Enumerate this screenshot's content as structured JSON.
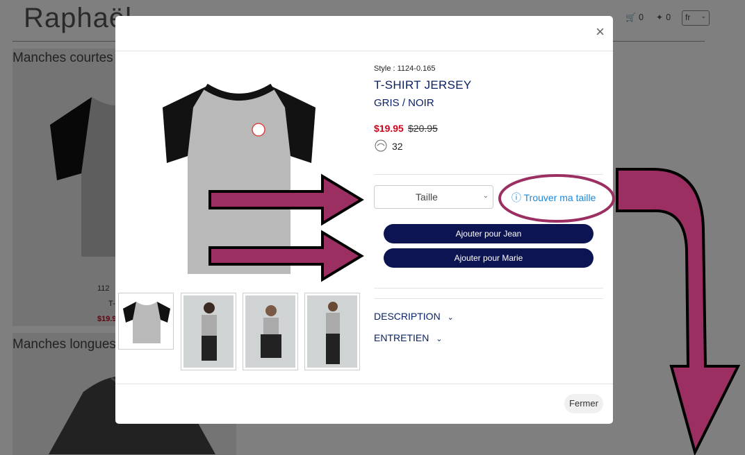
{
  "background": {
    "logo_text": "Raphaël",
    "cart_count": "0",
    "points_count": "0",
    "lang": "fr",
    "sections": [
      "Manches courtes",
      "Manches longues"
    ],
    "card_partial": [
      "112",
      "T-",
      "$19.9"
    ]
  },
  "modal": {
    "close_icon": "×",
    "product": {
      "style": "Style : 1124-0.165",
      "name": "T-SHIRT JERSEY",
      "color": "GRIS / NOIR",
      "price_now": "$19.95",
      "price_old": "$20.95",
      "points": "32"
    },
    "size_select": {
      "label": "Taille"
    },
    "size_link": "ⓘ Trouver ma taille",
    "buttons": {
      "add_jean": "Ajouter pour Jean",
      "add_marie": "Ajouter pour Marie"
    },
    "accordions": [
      {
        "label": "DESCRIPTION"
      },
      {
        "label": "ENTRETIEN"
      }
    ],
    "footer_close": "Fermer"
  },
  "colors": {
    "accent_navy": "#0a2166",
    "button_navy": "#0d1452",
    "sale_red": "#d0021b",
    "link_blue": "#1e88d6",
    "annotation_magenta": "#9b2f62"
  }
}
